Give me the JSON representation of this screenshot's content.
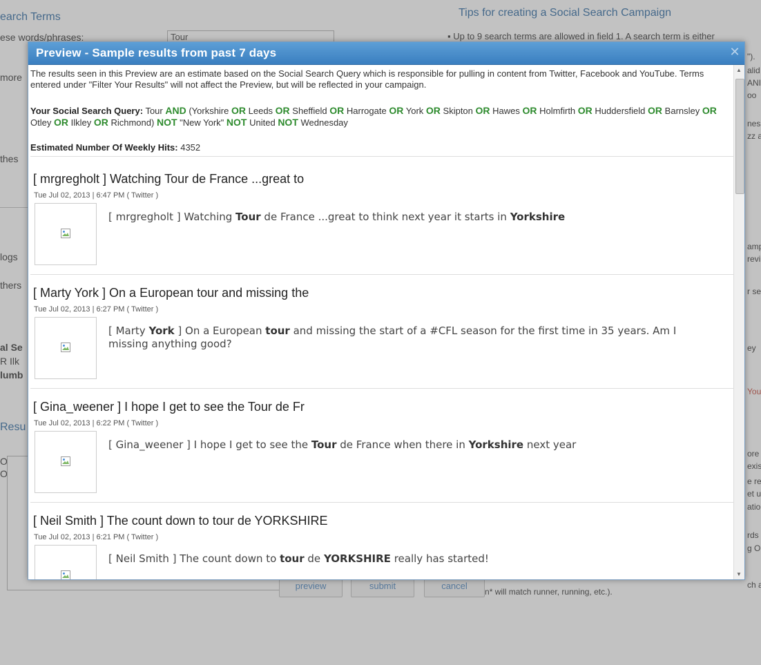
{
  "background": {
    "search_terms_heading": "earch Terms",
    "phrases_label": "ese words/phrases:",
    "search_input_value": "Tour",
    "tips_heading": "Tips for creating a Social Search Campaign",
    "tips_line1": "▪  Up to 9 search terms are allowed in field 1. A search term is either",
    "left_fragments": [
      "more",
      "thes",
      "logs",
      "thers",
      "al Se",
      "R Ilk",
      "lumb",
      "Resu",
      "OR \"",
      "OR L"
    ],
    "right_fragments": [
      "\").",
      "alid",
      "ANI",
      "oo",
      "nes",
      "zz a",
      "amp",
      "revi",
      "r se",
      "ey",
      "You",
      "ore",
      "exis",
      "e re",
      "et u",
      "atior",
      "rds",
      "g OF",
      "ch a"
    ],
    "bottom_tip": "(e.g. run* will match runner, running, etc.).",
    "buttons": {
      "preview": "preview",
      "submit": "submit",
      "cancel": "cancel"
    }
  },
  "modal": {
    "title": "Preview - Sample results from past 7 days",
    "close_glyph": "✕",
    "intro": "The results seen in this Preview are an estimate based on the Social Search Query which is responsible for pulling in content from Twitter, Facebook and YouTube. Terms entered under \"Filter Your Results\" will not affect the Preview, but will be reflected in your campaign.",
    "query_label": "Your Social Search Query:",
    "query_tokens": [
      {
        "t": "Tour",
        "op": false
      },
      {
        "t": "AND",
        "op": true
      },
      {
        "t": "(Yorkshire",
        "op": false
      },
      {
        "t": "OR",
        "op": true
      },
      {
        "t": "Leeds",
        "op": false
      },
      {
        "t": "OR",
        "op": true
      },
      {
        "t": "Sheffield",
        "op": false
      },
      {
        "t": "OR",
        "op": true
      },
      {
        "t": "Harrogate",
        "op": false
      },
      {
        "t": "OR",
        "op": true
      },
      {
        "t": "York",
        "op": false
      },
      {
        "t": "OR",
        "op": true
      },
      {
        "t": "Skipton",
        "op": false
      },
      {
        "t": "OR",
        "op": true
      },
      {
        "t": "Hawes",
        "op": false
      },
      {
        "t": "OR",
        "op": true
      },
      {
        "t": "Holmfirth",
        "op": false
      },
      {
        "t": "OR",
        "op": true
      },
      {
        "t": "Huddersfield",
        "op": false
      },
      {
        "t": "OR",
        "op": true
      },
      {
        "t": "Barnsley",
        "op": false
      },
      {
        "t": "OR",
        "op": true
      },
      {
        "t": "Otley",
        "op": false
      },
      {
        "t": "OR",
        "op": true
      },
      {
        "t": "Ilkley",
        "op": false
      },
      {
        "t": "OR",
        "op": true
      },
      {
        "t": "Richmond)",
        "op": false
      },
      {
        "t": "NOT",
        "op": true
      },
      {
        "t": "\"New York\"",
        "op": false
      },
      {
        "t": "NOT",
        "op": true
      },
      {
        "t": "United",
        "op": false
      },
      {
        "t": "NOT",
        "op": true
      },
      {
        "t": "Wednesday",
        "op": false
      }
    ],
    "hits_label": "Estimated Number Of Weekly Hits:",
    "hits_value": "4352",
    "results": [
      {
        "title": "[ mrgregholt ] Watching Tour de France ...great to",
        "meta": "Tue Jul 02, 2013 | 6:47 PM ( Twitter )",
        "text": [
          {
            "t": "[ mrgregholt ] Watching ",
            "b": false
          },
          {
            "t": "Tour",
            "b": true
          },
          {
            "t": " de France ...great to think next year it starts in ",
            "b": false
          },
          {
            "t": "Yorkshire",
            "b": true
          }
        ]
      },
      {
        "title": "[ Marty York ] On a European tour and missing the",
        "meta": "Tue Jul 02, 2013 | 6:27 PM ( Twitter )",
        "text": [
          {
            "t": "[ Marty ",
            "b": false
          },
          {
            "t": "York",
            "b": true
          },
          {
            "t": " ] On a European ",
            "b": false
          },
          {
            "t": "tour",
            "b": true
          },
          {
            "t": " and missing the start of a #CFL season for the first time in 35 years. Am I missing anything good?",
            "b": false
          }
        ]
      },
      {
        "title": "[ Gina_weener ] I hope I get to see the Tour de Fr",
        "meta": "Tue Jul 02, 2013 | 6:22 PM ( Twitter )",
        "text": [
          {
            "t": "[ Gina_weener ] I hope I get to see the ",
            "b": false
          },
          {
            "t": "Tour",
            "b": true
          },
          {
            "t": " de France when there in ",
            "b": false
          },
          {
            "t": "Yorkshire",
            "b": true
          },
          {
            "t": " next year",
            "b": false
          }
        ]
      },
      {
        "title": "[ Neil Smith ] The count down to tour de YORKSHIRE",
        "meta": "Tue Jul 02, 2013 | 6:21 PM ( Twitter )",
        "text": [
          {
            "t": "[ Neil Smith ] The count down to ",
            "b": false
          },
          {
            "t": "tour",
            "b": true
          },
          {
            "t": " de ",
            "b": false
          },
          {
            "t": "YORKSHIRE",
            "b": true
          },
          {
            "t": " really has started!",
            "b": false
          }
        ]
      }
    ]
  },
  "colors": {
    "accent": "#3a7fc0",
    "operator": "#2e8b2e"
  }
}
